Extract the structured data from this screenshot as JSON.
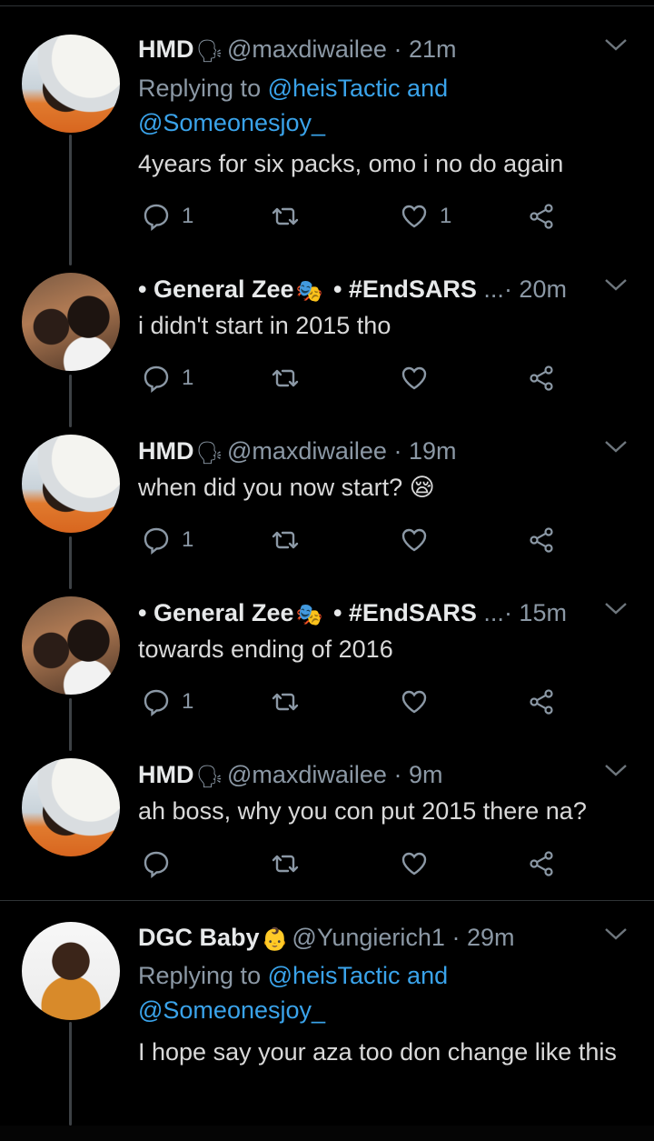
{
  "tweets": [
    {
      "name": "HMD",
      "emoji": "🗣",
      "handle": "@maxdiwailee",
      "time": "· 21m",
      "replying_label": "Replying to ",
      "replying_to_1": "@heisTactic and",
      "replying_to_2": "@Someonesjoy_",
      "text": "4years for six packs, omo i no do again",
      "replies": "1",
      "likes": "1"
    },
    {
      "prefix": "• ",
      "name": "General Zee",
      "emoji": "🎭",
      "suffix": " • #EndSARS",
      "more": " ...",
      "time": "· 20m",
      "text": "i didn't start in 2015 tho",
      "replies": "1"
    },
    {
      "name": "HMD",
      "emoji": "🗣",
      "handle": "@maxdiwailee",
      "time": "· 19m",
      "text": "when did you now start? 😪",
      "replies": "1"
    },
    {
      "prefix": "• ",
      "name": "General Zee",
      "emoji": "🎭",
      "suffix": " • #EndSARS",
      "more": " ...",
      "time": "· 15m",
      "text": "towards ending of 2016",
      "replies": "1"
    },
    {
      "name": "HMD",
      "emoji": "🗣",
      "handle": "@maxdiwailee",
      "time": "· 9m",
      "text": "ah boss, why you con put 2015 there na?"
    },
    {
      "name": "DGC Baby",
      "emoji": "👶",
      "handle": "@Yungierich1",
      "time": "· 29m",
      "replying_label": "Replying to ",
      "replying_to_1": "@heisTactic and",
      "replying_to_2": "@Someonesjoy_",
      "text": "I hope say your aza too don change like this"
    }
  ],
  "icons": {
    "reply": "reply-icon",
    "retweet": "retweet-icon",
    "like": "heart-icon",
    "share": "share-icon",
    "menu": "chevron-down-icon"
  },
  "colors": {
    "background": "#000000",
    "link": "#3aa3ea",
    "muted": "#8b98a5"
  }
}
